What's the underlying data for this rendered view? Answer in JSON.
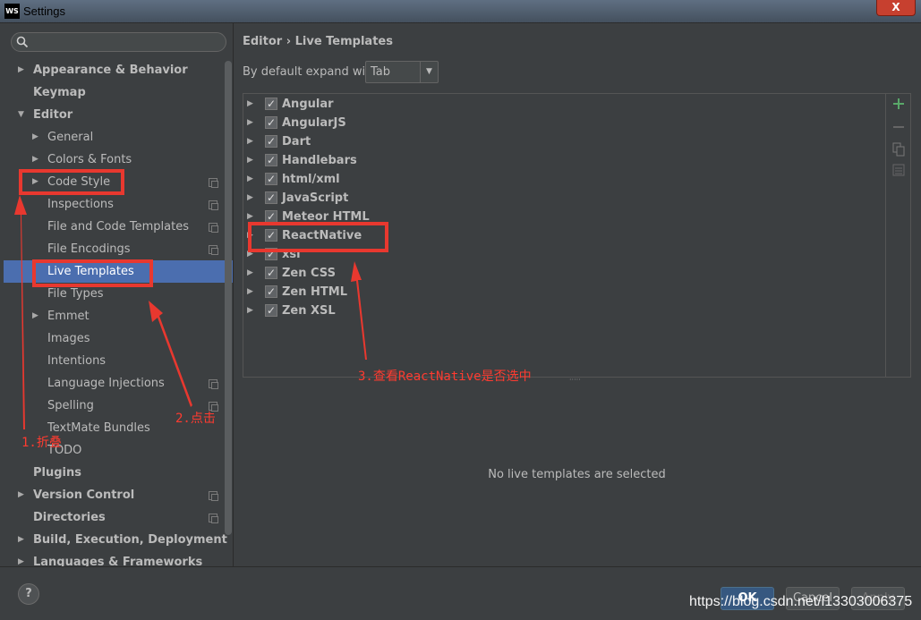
{
  "window": {
    "title": "Settings",
    "logo": "WS",
    "close_label": "X"
  },
  "search": {
    "placeholder": ""
  },
  "tree": [
    {
      "label": "Appearance & Behavior",
      "bold": true,
      "arrow": "right",
      "indent": 0,
      "copy": false
    },
    {
      "label": "Keymap",
      "bold": true,
      "arrow": "",
      "indent": 0,
      "copy": false
    },
    {
      "label": "Editor",
      "bold": true,
      "arrow": "down",
      "indent": 0,
      "copy": false
    },
    {
      "label": "General",
      "bold": false,
      "arrow": "right",
      "indent": 1,
      "copy": false
    },
    {
      "label": "Colors & Fonts",
      "bold": false,
      "arrow": "right",
      "indent": 1,
      "copy": false
    },
    {
      "label": "Code Style",
      "bold": false,
      "arrow": "right",
      "indent": 1,
      "copy": true
    },
    {
      "label": "Inspections",
      "bold": false,
      "arrow": "",
      "indent": 1,
      "copy": true
    },
    {
      "label": "File and Code Templates",
      "bold": false,
      "arrow": "",
      "indent": 1,
      "copy": true
    },
    {
      "label": "File Encodings",
      "bold": false,
      "arrow": "",
      "indent": 1,
      "copy": true
    },
    {
      "label": "Live Templates",
      "bold": false,
      "arrow": "",
      "indent": 1,
      "copy": false,
      "selected": true
    },
    {
      "label": "File Types",
      "bold": false,
      "arrow": "",
      "indent": 1,
      "copy": false
    },
    {
      "label": "Emmet",
      "bold": false,
      "arrow": "right",
      "indent": 1,
      "copy": false
    },
    {
      "label": "Images",
      "bold": false,
      "arrow": "",
      "indent": 1,
      "copy": false
    },
    {
      "label": "Intentions",
      "bold": false,
      "arrow": "",
      "indent": 1,
      "copy": false
    },
    {
      "label": "Language Injections",
      "bold": false,
      "arrow": "",
      "indent": 1,
      "copy": true
    },
    {
      "label": "Spelling",
      "bold": false,
      "arrow": "",
      "indent": 1,
      "copy": true
    },
    {
      "label": "TextMate Bundles",
      "bold": false,
      "arrow": "",
      "indent": 1,
      "copy": false
    },
    {
      "label": "TODO",
      "bold": false,
      "arrow": "",
      "indent": 1,
      "copy": false
    },
    {
      "label": "Plugins",
      "bold": true,
      "arrow": "",
      "indent": 0,
      "copy": false
    },
    {
      "label": "Version Control",
      "bold": true,
      "arrow": "right",
      "indent": 0,
      "copy": true
    },
    {
      "label": "Directories",
      "bold": true,
      "arrow": "",
      "indent": 0,
      "copy": true
    },
    {
      "label": "Build, Execution, Deployment",
      "bold": true,
      "arrow": "right",
      "indent": 0,
      "copy": false
    },
    {
      "label": "Languages & Frameworks",
      "bold": true,
      "arrow": "right",
      "indent": 0,
      "copy": false
    }
  ],
  "breadcrumb": "Editor › Live Templates",
  "expand": {
    "label": "By default expand with",
    "value": "Tab"
  },
  "templates": [
    "Angular",
    "AngularJS",
    "Dart",
    "Handlebars",
    "html/xml",
    "JavaScript",
    "Meteor HTML",
    "ReactNative",
    "xsl",
    "Zen CSS",
    "Zen HTML",
    "Zen XSL"
  ],
  "side_toolbar": {
    "add_icon": "plus-icon",
    "remove_icon": "minus-icon",
    "copy_icon": "copy-icon",
    "edit_icon": "list-icon"
  },
  "empty_message": "No live templates are selected",
  "buttons": {
    "ok": "OK",
    "cancel": "Cancel",
    "apply": "Apply",
    "help": "?"
  },
  "watermark": "https://blog.csdn.net/l13303006375",
  "annotations": {
    "step1": "1.折叠",
    "step2": "2.点击",
    "step3": "3.查看ReactNative是否选中",
    "color": "#e8382f"
  },
  "colors": {
    "selection": "#4b6eaf",
    "background": "#3c3f41",
    "ok_button": "#365880",
    "add_icon": "#59a869"
  }
}
